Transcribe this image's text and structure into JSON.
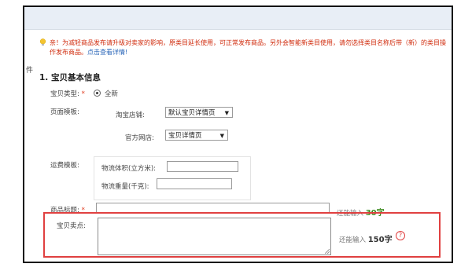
{
  "side_label": "件",
  "notice": {
    "text": "亲！为减轻商品发布请升级对卖家的影响，原类目延长使用，可正常发布商品。另外会智能新类目使用，请勿选择类目名称后带（新）的类目操作发布商品。",
    "link": "点击查看详情!"
  },
  "section": {
    "title": "1. 宝贝基本信息"
  },
  "item_type": {
    "label": "宝贝类型:",
    "required_mark": "*",
    "option": "全新"
  },
  "page_template": {
    "label": "页面模板:",
    "taobao_label": "淘宝店铺:",
    "taobao_value": "默认宝贝详情页",
    "official_label": "官方网店:",
    "official_value": "宝贝详情页"
  },
  "shipping": {
    "label": "运费模板:",
    "volume_label": "物流体积(立方米):",
    "weight_label": "物流重量(千克):"
  },
  "title_field": {
    "label": "商品标题:",
    "required_mark": "*",
    "hint_prefix": "还能输入",
    "remaining": "30字"
  },
  "selling_point": {
    "label": "宝贝卖点:",
    "hint_prefix": "还能输入",
    "remaining": "150字",
    "help_icon": "?"
  },
  "colors": {
    "notice": "#d02b0c",
    "link": "#2a66b8",
    "count": "#3b8a1d",
    "highlight_box": "#e04040"
  }
}
